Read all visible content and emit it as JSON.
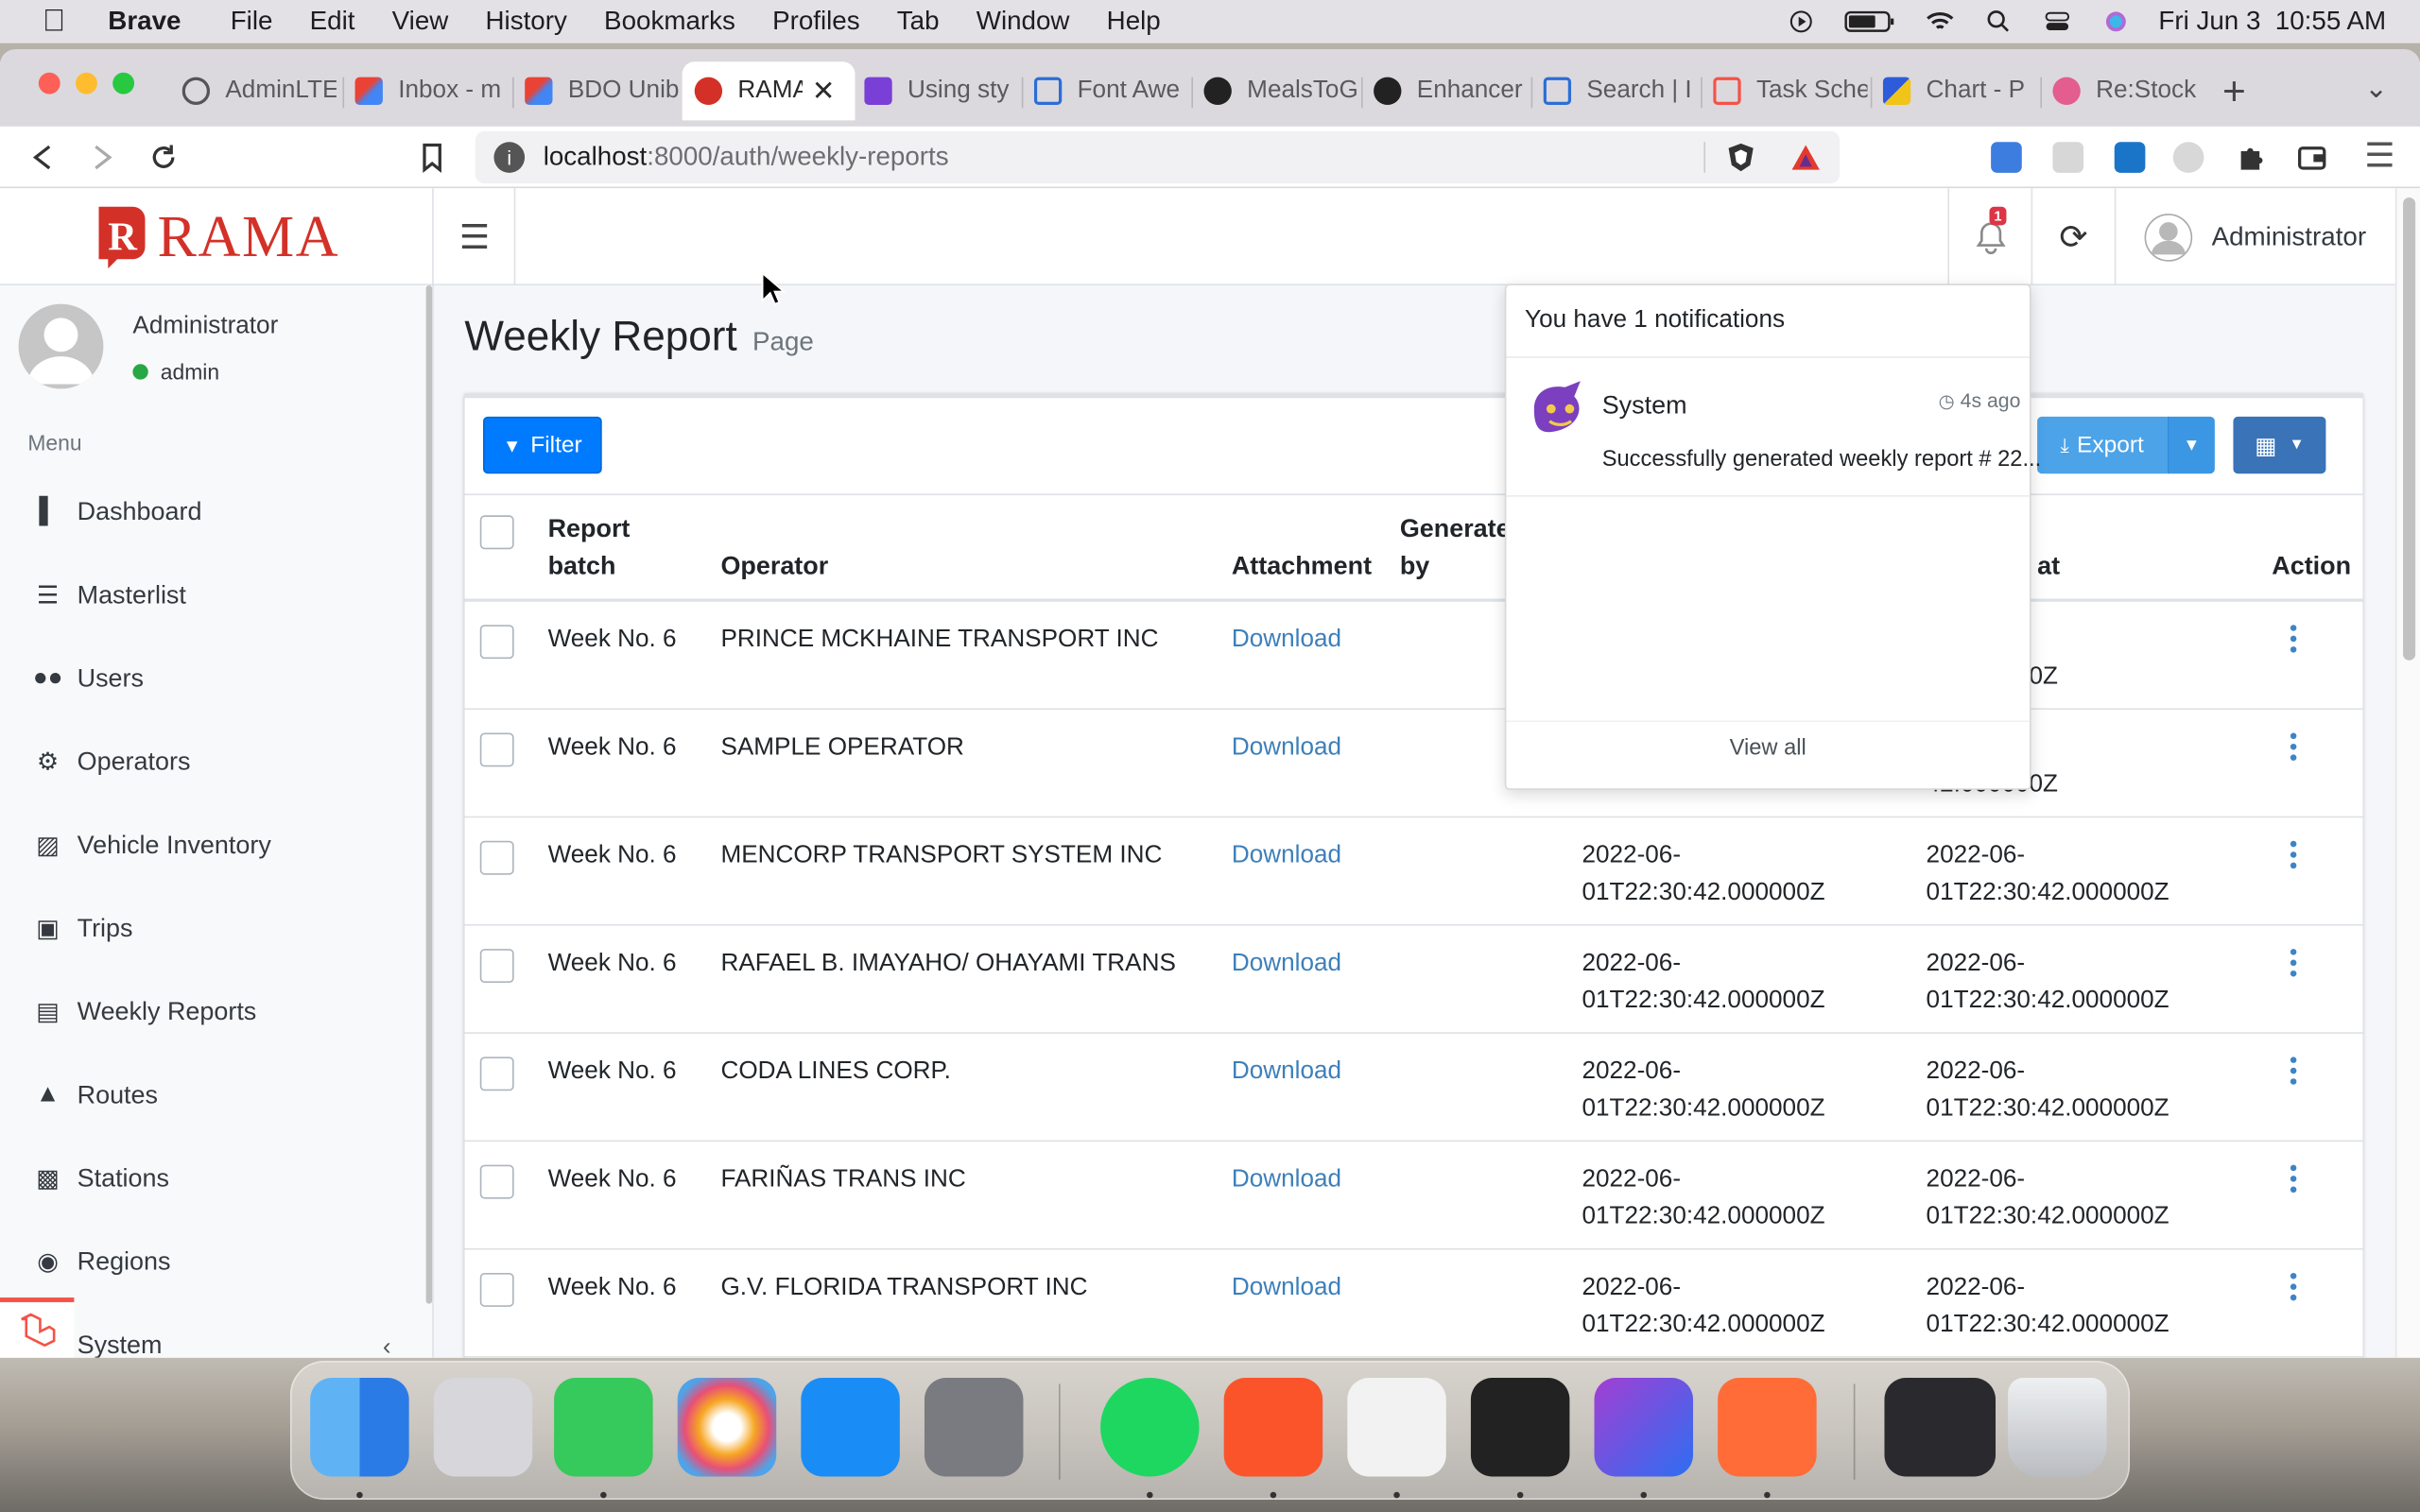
{
  "menubar": {
    "app": "Brave",
    "items": [
      "File",
      "Edit",
      "View",
      "History",
      "Bookmarks",
      "Profiles",
      "Tab",
      "Window",
      "Help"
    ],
    "datetime": "Fri Jun 3  10:55 AM"
  },
  "tabs": [
    "AdminLTE",
    "Inbox - m",
    "BDO Unib",
    "RAMA",
    "Using sty",
    "Font Awe",
    "MealsToG",
    "Enhancer",
    "Search | I",
    "Task Sche",
    "Chart - P",
    "Re:Stock"
  ],
  "browser": {
    "url_host": "localhost",
    "url_path": ":8000/auth/weekly-reports"
  },
  "app": {
    "brand": "RAMA",
    "notifications_badge": "1",
    "user": "Administrator"
  },
  "sidebar": {
    "user_name": "Administrator",
    "user_role": "admin",
    "menu_header": "Menu",
    "items": [
      {
        "label": "Dashboard",
        "icon": "chart-bar-icon"
      },
      {
        "label": "Masterlist",
        "icon": "list-icon"
      },
      {
        "label": "Users",
        "icon": "users-icon"
      },
      {
        "label": "Operators",
        "icon": "cogs-icon"
      },
      {
        "label": "Vehicle Inventory",
        "icon": "car-icon"
      },
      {
        "label": "Trips",
        "icon": "bus-icon"
      },
      {
        "label": "Weekly Reports",
        "icon": "file-pdf-icon"
      },
      {
        "label": "Routes",
        "icon": "road-icon"
      },
      {
        "label": "Stations",
        "icon": "train-icon"
      },
      {
        "label": "Regions",
        "icon": "globe-icon"
      },
      {
        "label": "System",
        "icon": "cog-icon"
      }
    ]
  },
  "page": {
    "title": "Weekly Report",
    "subtitle": "Page"
  },
  "toolbar": {
    "filter": "Filter",
    "export": "Export"
  },
  "table": {
    "headers": {
      "batch": "Report batch",
      "operator": "Operator",
      "attachment": "Attachment",
      "generated_by": "Generated by",
      "updated_at": "at",
      "action": "Action"
    },
    "rows": [
      {
        "batch": "Week No. 6",
        "operator": "PRINCE MCKHAINE TRANSPORT INC",
        "attachment": "Download",
        "created_a": "",
        "created_b": "",
        "updated_a": "",
        "updated_b": "19.000000Z"
      },
      {
        "batch": "Week No. 6",
        "operator": "SAMPLE OPERATOR",
        "attachment": "Download",
        "created_a": "",
        "created_b": "",
        "updated_a": "",
        "updated_b": "42.000000Z"
      },
      {
        "batch": "Week No. 6",
        "operator": "MENCORP TRANSPORT SYSTEM INC",
        "attachment": "Download",
        "created_a": "2022-06-",
        "created_b": "01T22:30:42.000000Z",
        "updated_a": "2022-06-",
        "updated_b": "01T22:30:42.000000Z"
      },
      {
        "batch": "Week No. 6",
        "operator": "RAFAEL B. IMAYAHO/ OHAYAMI TRANS",
        "attachment": "Download",
        "created_a": "2022-06-",
        "created_b": "01T22:30:42.000000Z",
        "updated_a": "2022-06-",
        "updated_b": "01T22:30:42.000000Z"
      },
      {
        "batch": "Week No. 6",
        "operator": "CODA LINES CORP.",
        "attachment": "Download",
        "created_a": "2022-06-",
        "created_b": "01T22:30:42.000000Z",
        "updated_a": "2022-06-",
        "updated_b": "01T22:30:42.000000Z"
      },
      {
        "batch": "Week No. 6",
        "operator": "FARIÑAS TRANS INC",
        "attachment": "Download",
        "created_a": "2022-06-",
        "created_b": "01T22:30:42.000000Z",
        "updated_a": "2022-06-",
        "updated_b": "01T22:30:42.000000Z"
      },
      {
        "batch": "Week No. 6",
        "operator": "G.V. FLORIDA TRANSPORT INC",
        "attachment": "Download",
        "created_a": "2022-06-",
        "created_b": "01T22:30:42.000000Z",
        "updated_a": "2022-06-",
        "updated_b": "01T22:30:42.000000Z"
      }
    ]
  },
  "notifications": {
    "header": "You have 1 notifications",
    "items": [
      {
        "from": "System",
        "time": "4s ago",
        "message": "Successfully generated weekly report # 22..."
      }
    ],
    "view_all": "View all"
  },
  "colors": {
    "brand_red": "#d33128",
    "primary": "#007bff",
    "link": "#3d7fba",
    "badge": "#dc3545"
  },
  "dock": [
    "finder-icon",
    "launchpad-icon",
    "messages-icon",
    "photos-icon",
    "app-store-icon",
    "system-preferences-icon",
    "spotify-icon",
    "brave-icon",
    "sequel-ace-icon",
    "terminal-icon",
    "phpstorm-icon",
    "postman-icon",
    "window-preview-icon",
    "trash-icon"
  ]
}
